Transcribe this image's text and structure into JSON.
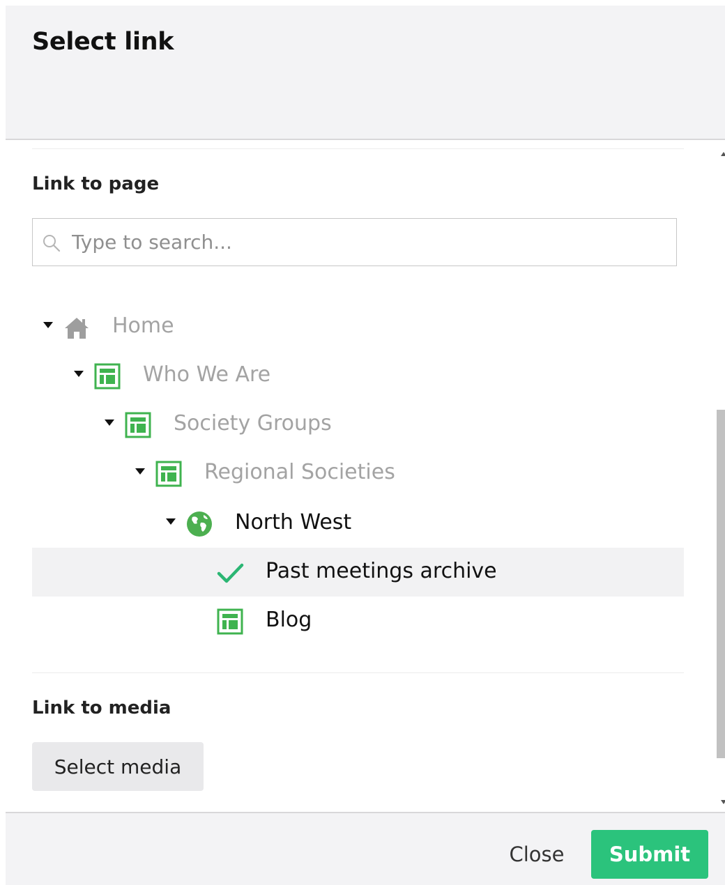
{
  "header": {
    "title": "Select link"
  },
  "link_to_page": {
    "label": "Link to page",
    "search_placeholder": "Type to search...",
    "tree": [
      {
        "label": "Home",
        "icon": "home-icon"
      },
      {
        "label": "Who We Are",
        "icon": "page-layout-icon"
      },
      {
        "label": "Society Groups",
        "icon": "page-layout-icon"
      },
      {
        "label": "Regional Societies",
        "icon": "page-layout-icon"
      },
      {
        "label": "North West",
        "icon": "globe-icon"
      },
      {
        "label": "Past meetings archive",
        "icon": "checkmark-icon",
        "selected": true
      },
      {
        "label": "Blog",
        "icon": "page-layout-icon"
      }
    ]
  },
  "link_to_media": {
    "label": "Link to media",
    "button_label": "Select media"
  },
  "footer": {
    "close_label": "Close",
    "submit_label": "Submit"
  },
  "colors": {
    "accent_green": "#2bc37c",
    "icon_green": "#3fb34f",
    "dim_text": "#a3a3a3",
    "selected_row": "#f2f2f3"
  }
}
